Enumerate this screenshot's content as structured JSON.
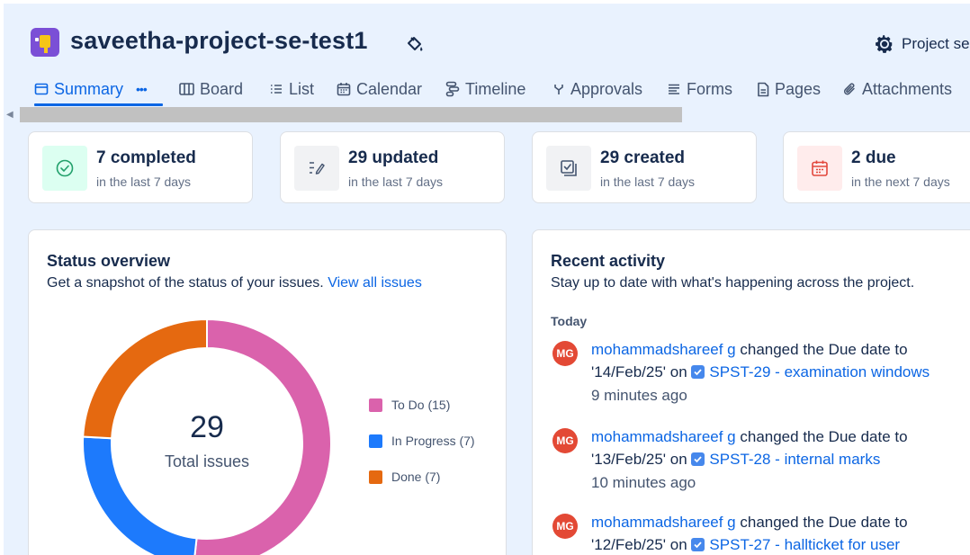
{
  "header": {
    "project_name": "saveetha-project-se-test1",
    "settings_label": "Project se"
  },
  "tabs": [
    {
      "label": "Summary",
      "icon": "summary-icon",
      "active": true
    },
    {
      "label": "Board",
      "icon": "board-icon"
    },
    {
      "label": "List",
      "icon": "list-icon"
    },
    {
      "label": "Calendar",
      "icon": "calendar-icon"
    },
    {
      "label": "Timeline",
      "icon": "timeline-icon"
    },
    {
      "label": "Approvals",
      "icon": "approvals-icon"
    },
    {
      "label": "Forms",
      "icon": "forms-icon"
    },
    {
      "label": "Pages",
      "icon": "pages-icon"
    },
    {
      "label": "Attachments",
      "icon": "attachment-icon"
    }
  ],
  "tab_more": "•••",
  "stats": [
    {
      "value": "7 completed",
      "sub": "in the last 7 days",
      "icon": "check-circle-icon",
      "color": "#dcfff1"
    },
    {
      "value": "29 updated",
      "sub": "in the last 7 days",
      "icon": "edit-icon",
      "color": "#f1f2f4"
    },
    {
      "value": "29 created",
      "sub": "in the last 7 days",
      "icon": "create-icon",
      "color": "#f1f2f4"
    },
    {
      "value": "2 due",
      "sub": "in the next 7 days",
      "icon": "calendar-icon",
      "color": "#ffecec"
    }
  ],
  "status_overview": {
    "title": "Status overview",
    "desc": "Get a snapshot of the status of your issues.",
    "link": "View all issues",
    "total": "29",
    "total_label": "Total issues"
  },
  "chart_data": {
    "type": "pie",
    "title": "",
    "categories": [
      "To Do",
      "In Progress",
      "Done"
    ],
    "values": [
      15,
      7,
      7
    ],
    "colors": [
      "#da62ac",
      "#1d7afc",
      "#e56910"
    ],
    "legend": [
      "To Do (15)",
      "In Progress (7)",
      "Done (7)"
    ],
    "legend_position": "right"
  },
  "recent_activity": {
    "title": "Recent activity",
    "desc": "Stay up to date with what's happening across the project.",
    "day": "Today",
    "items": [
      {
        "avatar": "MG",
        "user": "mohammadshareef g",
        "action": " changed the Due date to",
        "date": "'14/Feb/25' on",
        "issue": "SPST-29 - examination windows",
        "time": "9 minutes ago"
      },
      {
        "avatar": "MG",
        "user": "mohammadshareef g",
        "action": " changed the Due date to",
        "date": "'13/Feb/25' on",
        "issue": "SPST-28 - internal marks",
        "time": "10 minutes ago"
      },
      {
        "avatar": "MG",
        "user": "mohammadshareef g",
        "action": " changed the Due date to",
        "date": "'12/Feb/25' on",
        "issue": "SPST-27 - hallticket for user",
        "time": ""
      }
    ]
  }
}
